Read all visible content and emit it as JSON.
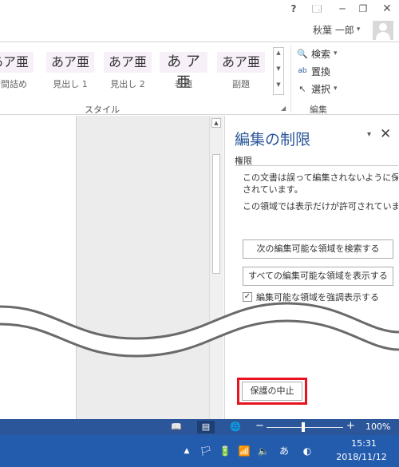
{
  "window": {
    "help": "?",
    "ribbon_options": "🗔",
    "minimize": "─",
    "maximize": "❐",
    "close": "✕"
  },
  "user": {
    "name": "秋葉 一郎",
    "dropdown": "▾"
  },
  "ribbon": {
    "styles": [
      {
        "sample": "あア亜",
        "label": "行間詰め"
      },
      {
        "sample": "あア亜",
        "label": "見出し 1"
      },
      {
        "sample": "あア亜",
        "label": "見出し 2"
      },
      {
        "sample": "あ ア 亜",
        "label": "表題"
      },
      {
        "sample": "あア亜",
        "label": "副題"
      }
    ],
    "styles_group_label": "スタイル",
    "editing_group_label": "編集",
    "editing": [
      {
        "icon": "search-icon",
        "glyph": "🔍",
        "label": "検索",
        "dropdown": "▾"
      },
      {
        "icon": "replace-icon",
        "glyph": "ab",
        "label": "置換",
        "dropdown": ""
      },
      {
        "icon": "select-icon",
        "glyph": "↖",
        "label": "選択",
        "dropdown": "▾"
      }
    ]
  },
  "pane": {
    "title": "編集の制限",
    "menu": "▾",
    "close": "✕",
    "section": "権限",
    "text1_line1": "この文書は誤って編集されないように保護",
    "text1_line2": "されています。",
    "text2": "この領域では表示だけが許可されていま",
    "find_next_button": "次の編集可能な領域を検索する",
    "show_all_button": "すべての編集可能な領域を表示する",
    "highlight_label": "編集可能な領域を強調表示する",
    "highlight_checked": "✓",
    "stop_protection_button": "保護の中止"
  },
  "statusbar": {
    "read_mode": "📖",
    "print_layout": "▤",
    "web_layout": "🌐",
    "zoom_minus": "−",
    "zoom_plus": "+",
    "zoom_level": "100%",
    "zoom_value": 100
  },
  "taskbar": {
    "tray_up": "▲",
    "tray_icons": [
      "🏳",
      "🔋",
      "📶",
      "🔈",
      "あ",
      "◐"
    ],
    "time": "15:31",
    "date": "2018/11/12"
  },
  "colors": {
    "accent": "#2b579a",
    "highlight_frame": "#e8131f",
    "taskbar": "#245cad"
  }
}
